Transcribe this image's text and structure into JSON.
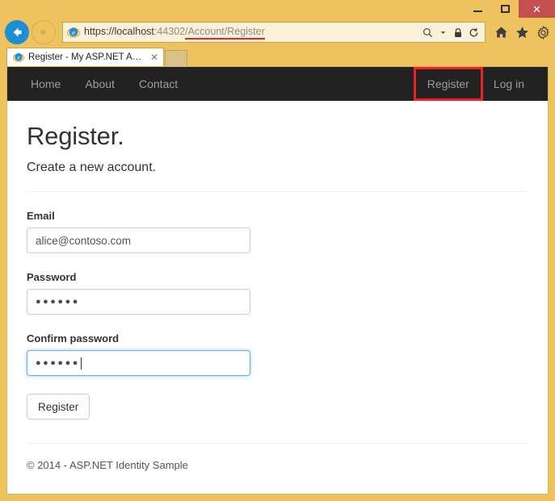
{
  "browser": {
    "window_controls": {
      "minimize": "minimize-button",
      "maximize": "maximize-button",
      "close": "✕"
    },
    "back_label": "←",
    "forward_label": "→",
    "url": {
      "scheme": "https://",
      "host": "localhost",
      "port": ":44302",
      "path": "/Account/Register",
      "full": "https://localhost:44302/Account/Register"
    },
    "address_icons": {
      "search": "⌕",
      "search_dropdown": "▾",
      "lock": "lock-icon",
      "refresh": "↻"
    },
    "toolbar_icons": {
      "home": "home-icon",
      "favorites": "★",
      "settings": "gear-icon"
    },
    "tab": {
      "title": "Register - My ASP.NET App...",
      "close": "✕"
    },
    "new_tab_label": ""
  },
  "site": {
    "nav_left": [
      {
        "label": "Home"
      },
      {
        "label": "About"
      },
      {
        "label": "Contact"
      }
    ],
    "nav_right": [
      {
        "label": "Register",
        "highlighted": true
      },
      {
        "label": "Log in",
        "highlighted": false
      }
    ],
    "page": {
      "title": "Register.",
      "subtitle": "Create a new account.",
      "fields": {
        "email": {
          "label": "Email",
          "value": "alice@contoso.com",
          "placeholder": ""
        },
        "password": {
          "label": "Password",
          "value": "●●●●●●",
          "placeholder": ""
        },
        "confirm_password": {
          "label": "Confirm password",
          "value": "●●●●●●",
          "placeholder": "",
          "focused": true
        }
      },
      "submit_label": "Register",
      "footer": "© 2014 - ASP.NET Identity Sample"
    }
  },
  "colors": {
    "frame": "#eec25e",
    "navbar": "#222222",
    "nav_link": "#9d9d9d",
    "highlight": "#ee2222",
    "focus": "#66afe9",
    "close_button": "#c2504f",
    "back_button": "#1b8fd4"
  }
}
